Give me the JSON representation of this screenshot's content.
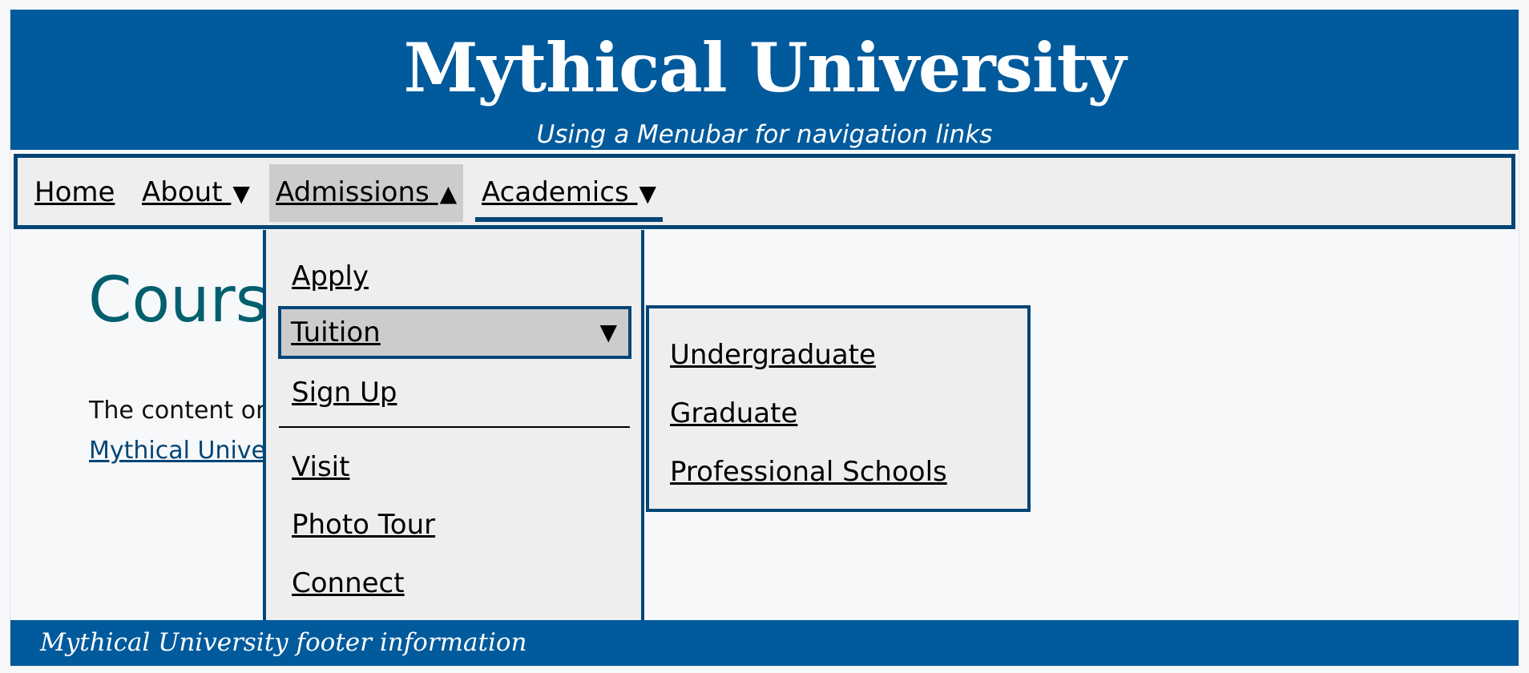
{
  "header": {
    "title": "Mythical University",
    "subtitle": "Using a Menubar for navigation links"
  },
  "menubar": {
    "items": [
      {
        "label": "Home",
        "has_submenu": false
      },
      {
        "label": "About ",
        "has_submenu": true,
        "caret": "▼"
      },
      {
        "label": "Admissions ",
        "has_submenu": true,
        "caret": "▲",
        "state": "open"
      },
      {
        "label": "Academics ",
        "has_submenu": true,
        "caret": "▼",
        "state": "focused"
      }
    ]
  },
  "admissions_menu": {
    "items": [
      {
        "label": "Apply"
      },
      {
        "label": "Tuition",
        "caret": "▼",
        "state": "open"
      },
      {
        "label": "Sign Up"
      },
      {
        "label": "Visit"
      },
      {
        "label": "Photo Tour"
      },
      {
        "label": "Connect"
      }
    ]
  },
  "tuition_submenu": {
    "items": [
      {
        "label": "Undergraduate"
      },
      {
        "label": "Graduate"
      },
      {
        "label": "Professional Schools"
      }
    ]
  },
  "content": {
    "heading": "Course",
    "text": "The content on",
    "link": "Mythical Unive"
  },
  "footer": {
    "text": "Mythical University footer information"
  },
  "colors": {
    "brand_blue": "#005a9c",
    "border_blue": "#034575",
    "menu_bg": "#eeeeee",
    "highlight_bg": "#cccccc",
    "heading_teal": "#035f6e"
  }
}
